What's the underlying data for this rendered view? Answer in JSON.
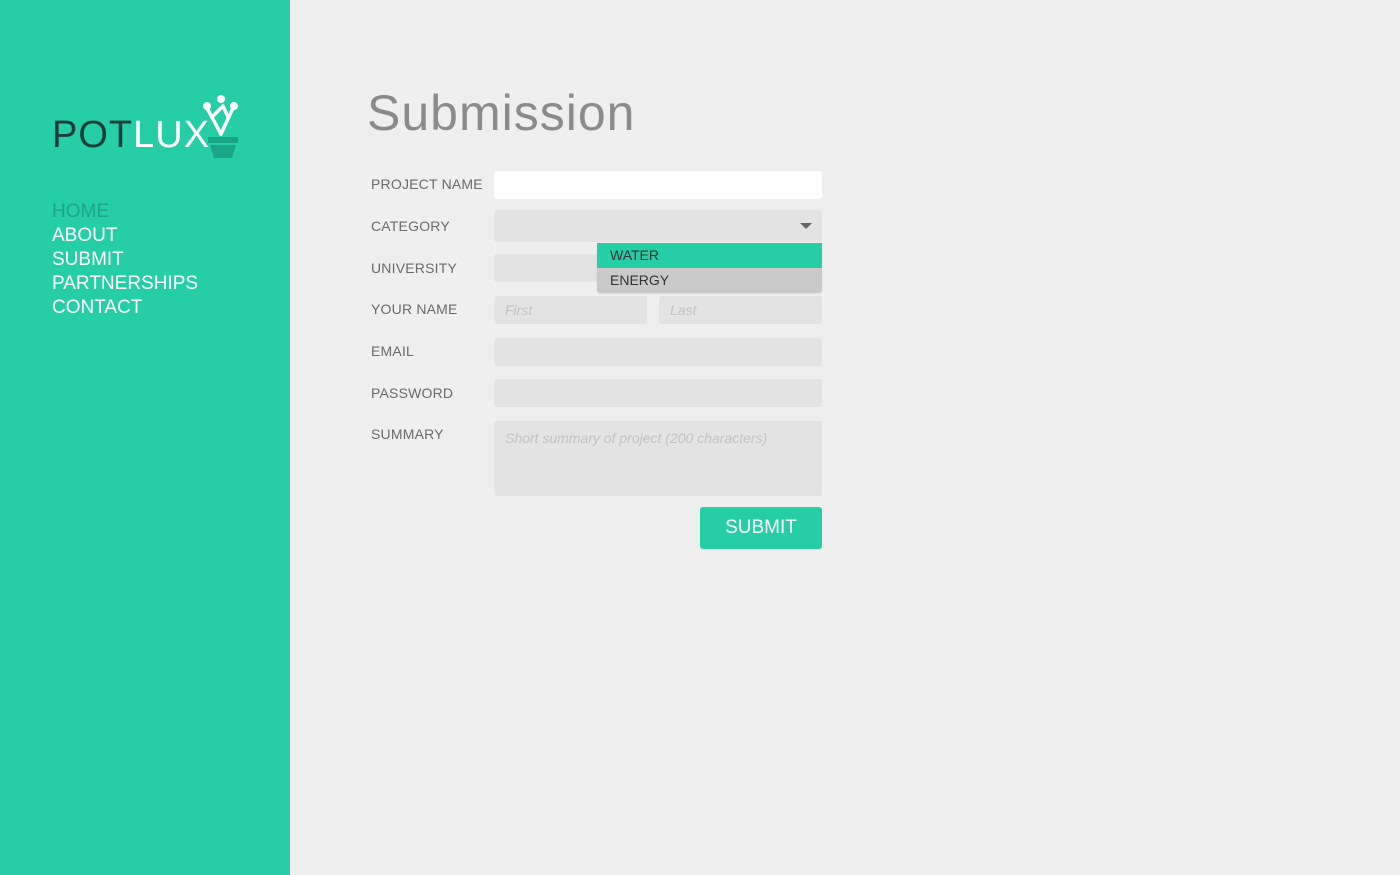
{
  "brand": {
    "logo_part1": "POT",
    "logo_part2": "LUX"
  },
  "nav": {
    "items": [
      {
        "label": "HOME",
        "active": true
      },
      {
        "label": "ABOUT",
        "active": false
      },
      {
        "label": "SUBMIT",
        "active": false
      },
      {
        "label": "PARTNERSHIPS",
        "active": false
      },
      {
        "label": "CONTACT",
        "active": false
      }
    ]
  },
  "page": {
    "title": "Submission"
  },
  "form": {
    "project_name": {
      "label": "PROJECT NAME",
      "value": ""
    },
    "category": {
      "label": "CATEGORY",
      "value": "",
      "options": [
        "WATER",
        "ENERGY"
      ],
      "highlighted_option": "WATER"
    },
    "university": {
      "label": "UNIVERSITY",
      "value": ""
    },
    "your_name": {
      "label": "YOUR NAME",
      "first_placeholder": "First",
      "last_placeholder": "Last"
    },
    "email": {
      "label": "EMAIL",
      "value": ""
    },
    "password": {
      "label": "PASSWORD",
      "value": ""
    },
    "summary": {
      "label": "SUMMARY",
      "placeholder": "Short summary of project (200 characters)"
    },
    "submit_label": "SUBMIT"
  },
  "colors": {
    "accent": "#25cea4",
    "accent_dark": "#1e3d39",
    "background": "#efefef",
    "field": "#e3e3e3"
  }
}
